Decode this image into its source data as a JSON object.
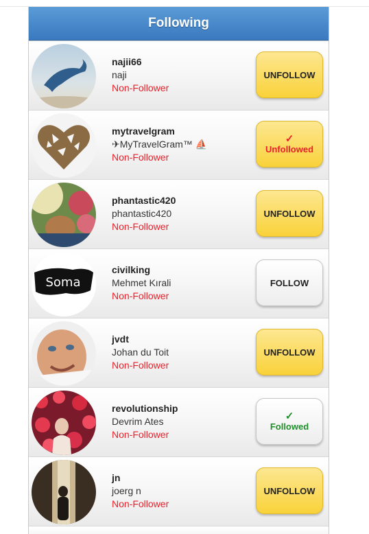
{
  "header": {
    "title": "Following"
  },
  "rows": [
    {
      "username": "najii66",
      "fullname": "naji",
      "status": "Non-Follower",
      "button": {
        "label": "UNFOLLOW",
        "check": ""
      }
    },
    {
      "username": "mytravelgram",
      "fullname": "✈MyTravelGram™ ⛵",
      "status": "Non-Follower",
      "button": {
        "label": "Unfollowed",
        "check": "✓"
      }
    },
    {
      "username": "phantastic420",
      "fullname": "phantastic420",
      "status": "Non-Follower",
      "button": {
        "label": "UNFOLLOW",
        "check": ""
      }
    },
    {
      "username": "civilking",
      "fullname": "Mehmet Kırali",
      "status": "Non-Follower",
      "button": {
        "label": "FOLLOW",
        "check": ""
      }
    },
    {
      "username": "jvdt",
      "fullname": "Johan du Toit",
      "status": "Non-Follower",
      "button": {
        "label": "UNFOLLOW",
        "check": ""
      }
    },
    {
      "username": "revolutionship",
      "fullname": "Devrim Ates",
      "status": "Non-Follower",
      "button": {
        "label": "Followed",
        "check": "✓"
      }
    },
    {
      "username": "jn",
      "fullname": "joerg n",
      "status": "Non-Follower",
      "button": {
        "label": "UNFOLLOW",
        "check": ""
      }
    }
  ],
  "avatar_texts": {
    "civilking": "Soma"
  },
  "colors": {
    "header": "#3a79bf",
    "status_red": "#e8202a",
    "button_yellow": "#f9d23a",
    "followed_green": "#1e8f2a"
  }
}
